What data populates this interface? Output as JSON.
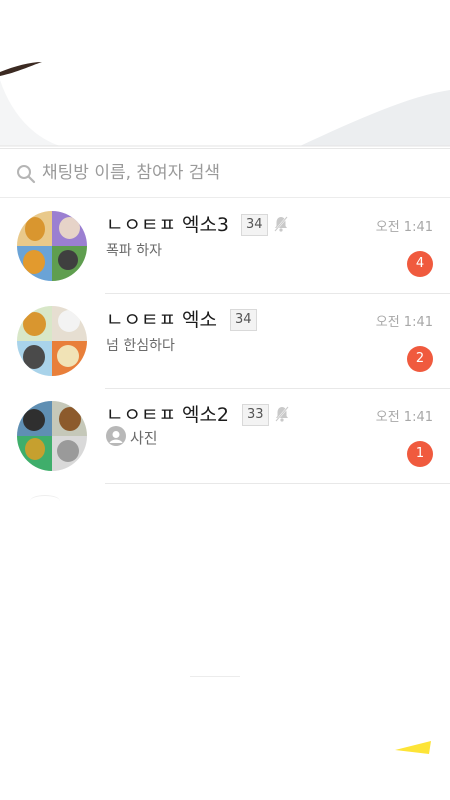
{
  "search": {
    "placeholder": "채팅방 이름, 참여자 검색",
    "icon": "search-icon"
  },
  "colors": {
    "unread_badge": "#f05a3e",
    "kakao_yellow": "#fde437",
    "divider": "#e8e8e8"
  },
  "chats": [
    {
      "name": "ㄴㅇㅌㅍ 엑소3",
      "member_count": "34",
      "muted": true,
      "time": "오전 1:41",
      "preview": "폭파 하자",
      "unread": "4",
      "preview_icon": null
    },
    {
      "name": "ㄴㅇㅌㅍ 엑소",
      "member_count": "34",
      "muted": false,
      "time": "오전 1:41",
      "preview": "넘 한심하다",
      "unread": "2",
      "preview_icon": null
    },
    {
      "name": "ㄴㅇㅌㅍ 엑소2",
      "member_count": "33",
      "muted": true,
      "time": "오전 1:41",
      "preview": "사진",
      "unread": "1",
      "preview_icon": "photo-icon"
    }
  ]
}
